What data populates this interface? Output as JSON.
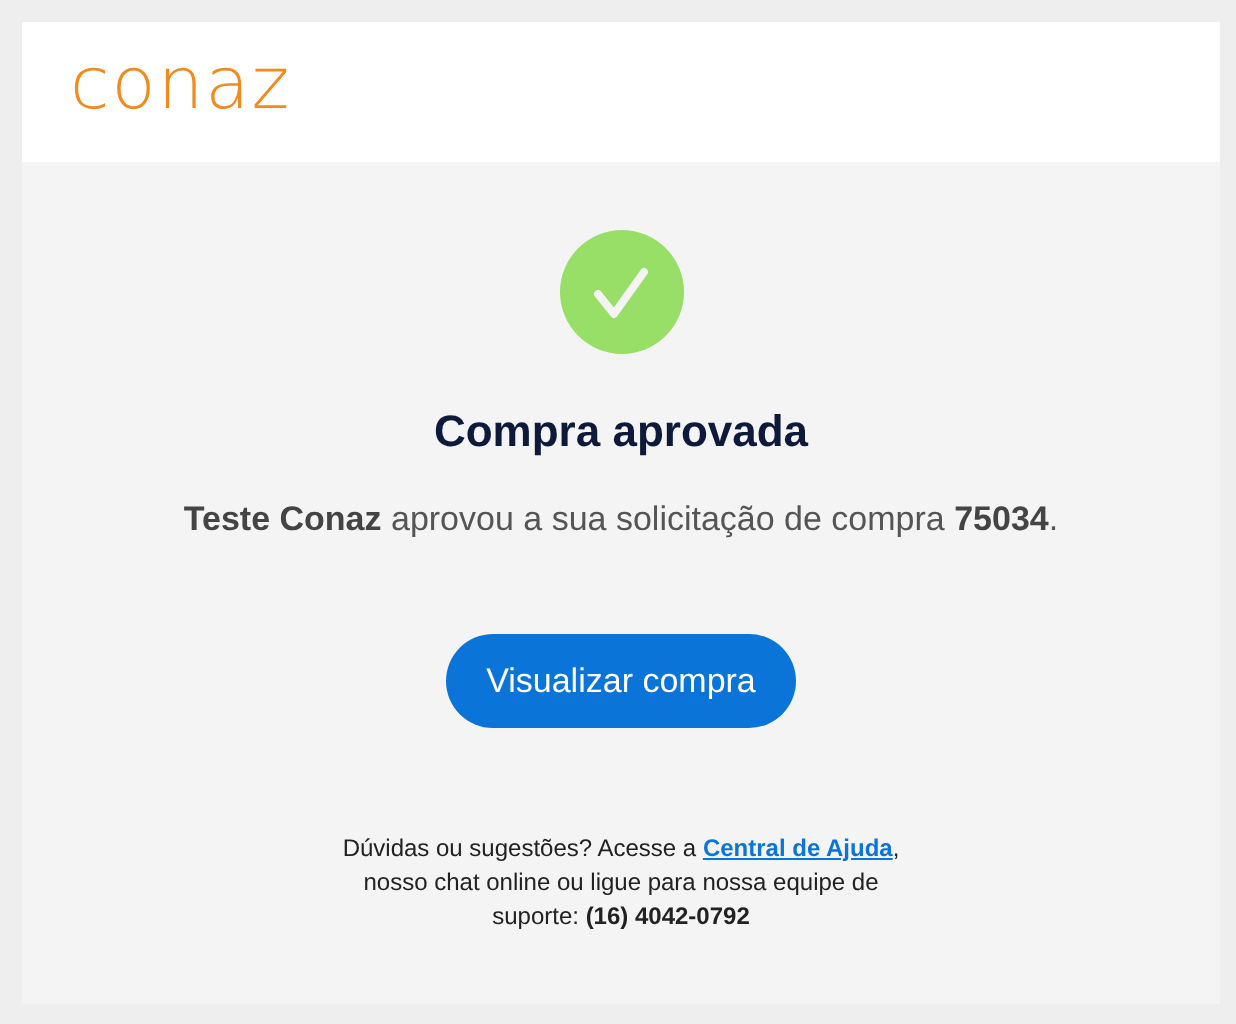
{
  "logo": "conaz",
  "status": {
    "kind": "approved"
  },
  "title": "Compra aprovada",
  "message": "**Teste Conaz** aprovou a sua solicitação de compra **75034**.",
  "button": "Visualizar compra",
  "footer": {
    "before": "Dúvidas ou sugestões? Acesse a",
    "link": "Central de Ajuda",
    "after": ", nosso chat online ou ligue para nossa equipe de suporte: **(16) 4042-0792**"
  }
}
